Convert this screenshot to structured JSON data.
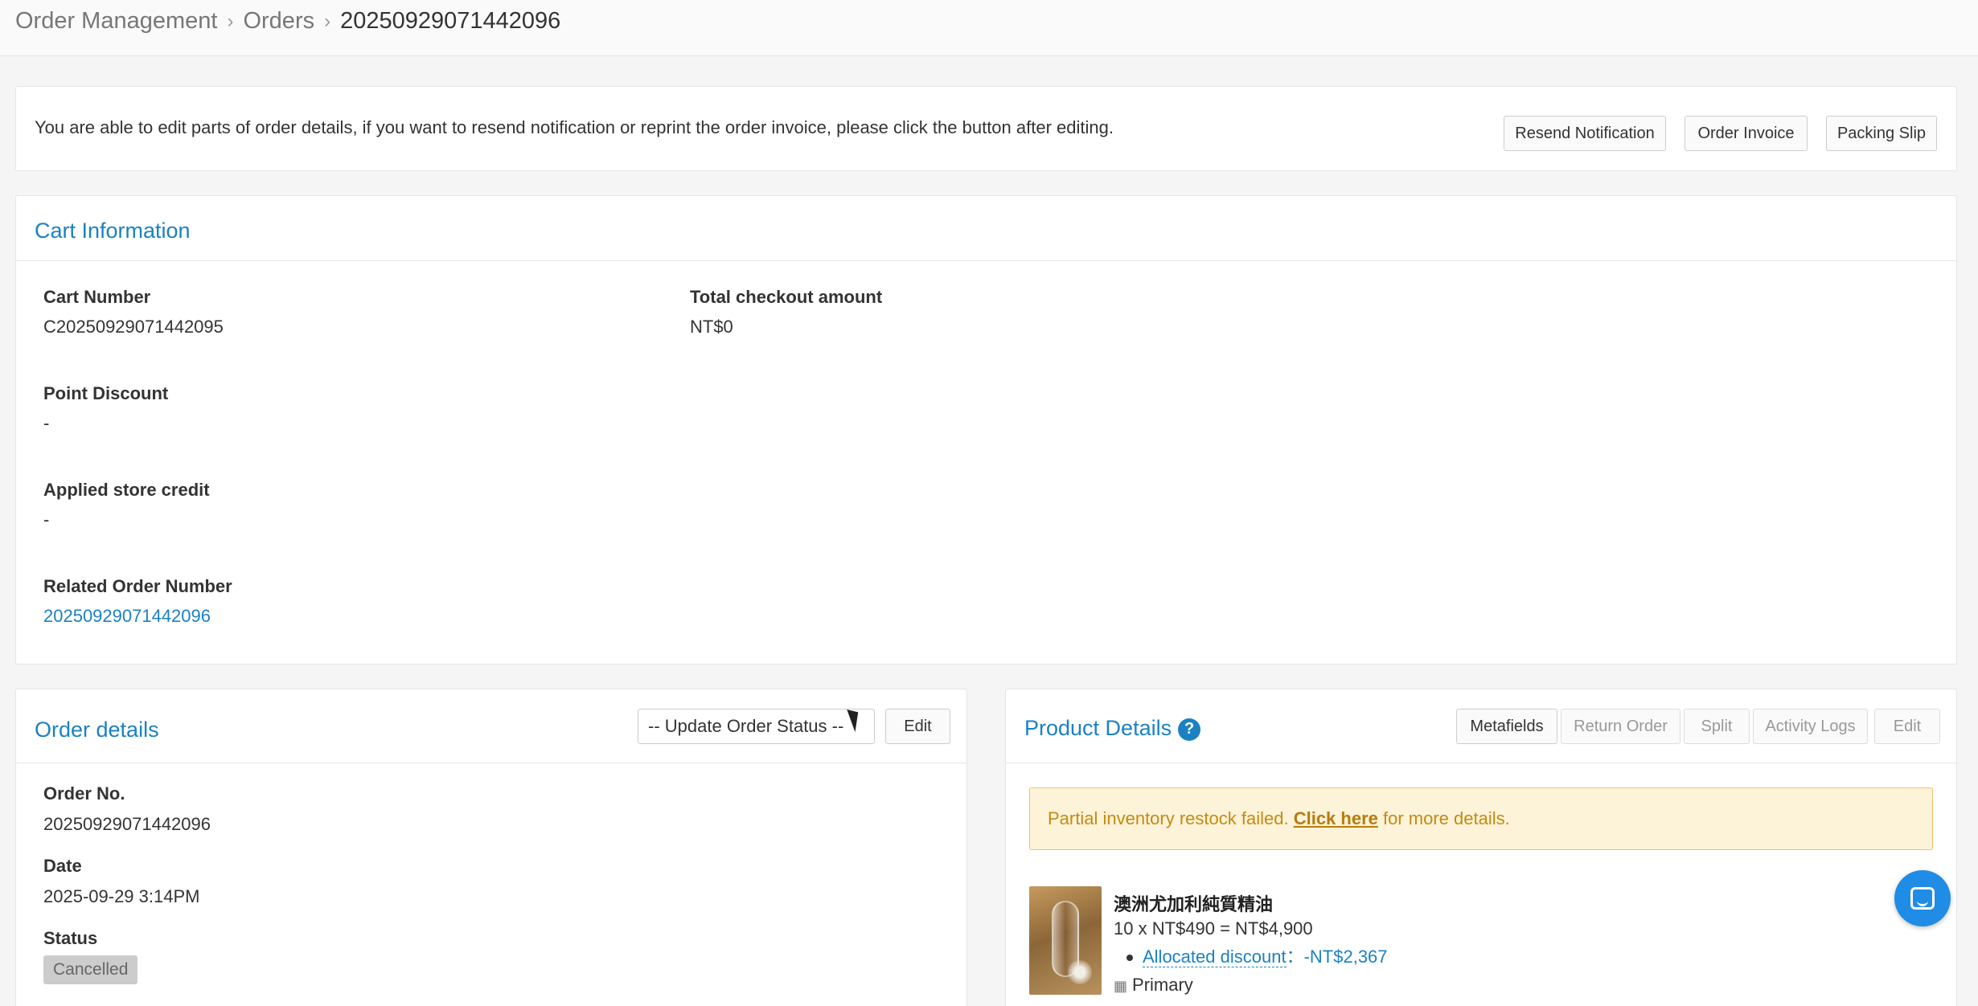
{
  "breadcrumb": {
    "items": [
      "Order Management",
      "Orders"
    ],
    "current": "20250929071442096"
  },
  "notice": {
    "text": "You are able to edit parts of order details, if you want to resend notification or reprint the order invoice, please click the button after editing.",
    "buttons": {
      "resend": "Resend Notification",
      "invoice": "Order Invoice",
      "packing": "Packing Slip"
    }
  },
  "cart": {
    "title": "Cart Information",
    "cart_number_label": "Cart Number",
    "cart_number": "C20250929071442095",
    "total_label": "Total checkout amount",
    "total": "NT$0",
    "point_discount_label": "Point Discount",
    "point_discount": "-",
    "store_credit_label": "Applied store credit",
    "store_credit": "-",
    "related_order_label": "Related Order Number",
    "related_order": "20250929071442096"
  },
  "order_details": {
    "title": "Order details",
    "status_select": "-- Update Order Status --",
    "edit": "Edit",
    "order_no_label": "Order No.",
    "order_no": "20250929071442096",
    "date_label": "Date",
    "date": "2025-09-29 3:14PM",
    "status_label": "Status",
    "status": "Cancelled"
  },
  "product_details": {
    "title": "Product Details",
    "help": "?",
    "buttons": {
      "metafields": "Metafields",
      "return_order": "Return Order",
      "split": "Split",
      "activity_logs": "Activity Logs",
      "edit": "Edit"
    },
    "alert": {
      "prefix": "Partial inventory restock failed. ",
      "link": "Click here",
      "suffix": " for more details."
    },
    "product": {
      "name": "澳洲尤加利純質精油",
      "line": "10 x NT$490 = NT$4,900",
      "discount_label": "Allocated discount",
      "discount_sep": "：",
      "discount_value": "-NT$2,367",
      "warehouse": "Primary"
    }
  },
  "colors": {
    "link": "#1b81c3",
    "alert_bg": "#fcf3d8",
    "alert_text": "#c58a11",
    "chat": "#1f8ce6"
  }
}
